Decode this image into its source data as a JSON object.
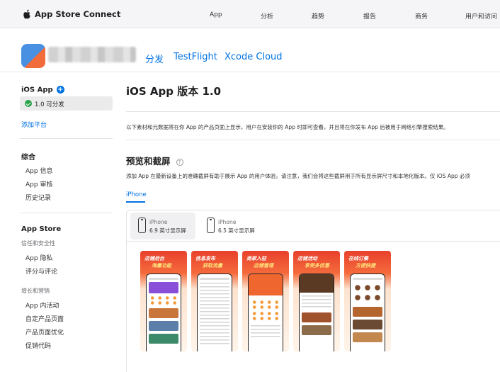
{
  "topnav": {
    "brand": "App Store Connect",
    "items": [
      "App",
      "分析",
      "趋势",
      "报告",
      "商务",
      "用户和访问"
    ]
  },
  "app_header": {
    "tabs": [
      "分发",
      "TestFlight",
      "Xcode Cloud"
    ]
  },
  "sidebar": {
    "ios_app_label": "iOS App",
    "plus_icon": "+",
    "version_label": "1.0 可分发",
    "add_platform": "添加平台",
    "general_heading": "综合",
    "general_items": [
      "App 信息",
      "App 审核",
      "历史记录"
    ],
    "app_store_heading": "App Store",
    "trust_safety_heading": "信任和安全性",
    "trust_items": [
      "App 隐私",
      "评分与评论"
    ],
    "growth_heading": "增长和营销",
    "growth_items": [
      "App 内活动",
      "自定产品页面",
      "产品页面优化",
      "促销代码"
    ]
  },
  "main": {
    "title": "iOS App 版本 1.0",
    "description": "以下素材和元数据将在你 App 的产品页面上显示，用户在安装你的 App 时即可查看，并且将在你发布 App 后被用于网络引擎搜索结果。",
    "preview_title": "预览和截屏",
    "help_icon": "?",
    "preview_description": "添加 App 在最新设备上的准确截屏有助于展示 App 的用户体验。请注意，我们会将这些截屏用于所有显示屏尺寸和本地化版本。仅 iOS App 必须",
    "device_family_tab": "iPhone",
    "device_tabs": [
      {
        "name": "iPhone",
        "size": "6.9 英寸显示屏"
      },
      {
        "name": "iPhone",
        "size": "6.5 英寸显示屏"
      }
    ],
    "screenshots": [
      {
        "line1": "店铺后台",
        "line2": "海量功能"
      },
      {
        "line1": "信息发布",
        "line2": "获取流量"
      },
      {
        "line1": "商家入驻",
        "line2": "店铺管理"
      },
      {
        "line1": "店铺活动",
        "line2": "享受多优惠"
      },
      {
        "line1": "在线订餐",
        "line2": "方便快捷"
      }
    ]
  },
  "colors": {
    "accent": "#0071e3",
    "success": "#2aa14a",
    "promo_red": "#e8402c"
  }
}
